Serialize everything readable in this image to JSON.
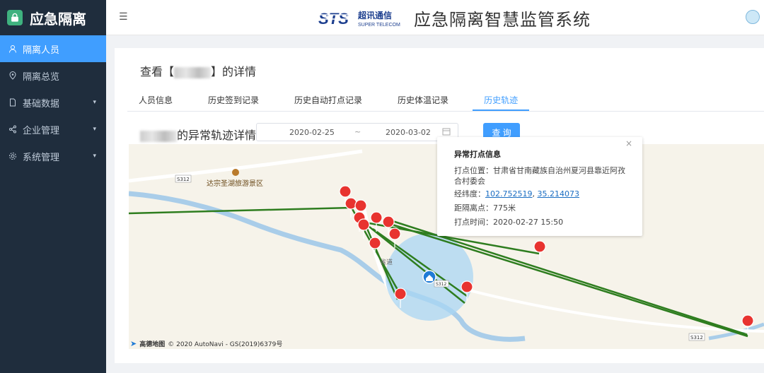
{
  "sidebar": {
    "brand": "应急隔离",
    "items": [
      {
        "label": "隔离人员",
        "icon": "user-icon",
        "active": true,
        "expandable": false
      },
      {
        "label": "隔离总览",
        "icon": "location-icon",
        "active": false,
        "expandable": false
      },
      {
        "label": "基础数据",
        "icon": "document-icon",
        "active": false,
        "expandable": true
      },
      {
        "label": "企业管理",
        "icon": "share-icon",
        "active": false,
        "expandable": true
      },
      {
        "label": "系统管理",
        "icon": "gear-icon",
        "active": false,
        "expandable": true
      }
    ]
  },
  "header": {
    "logo_cn": "超讯通信",
    "logo_en": "SUPER TELECOM",
    "system_title": "应急隔离智慧监管系统"
  },
  "detail": {
    "title_prefix": "查看【",
    "title_suffix": "】的详情",
    "tabs": [
      {
        "label": "人员信息",
        "active": false
      },
      {
        "label": "历史签到记录",
        "active": false
      },
      {
        "label": "历史自动打点记录",
        "active": false
      },
      {
        "label": "历史体温记录",
        "active": false
      },
      {
        "label": "历史轨迹",
        "active": true
      }
    ],
    "sub_title_suffix": "的异常轨迹详情",
    "date_start": "2020-02-25",
    "date_sep": "~",
    "date_end": "2020-03-02",
    "query_label": "查 询"
  },
  "map": {
    "labels": {
      "scenic": "达宗圣湖旅游景区",
      "road1": "S312",
      "road2": "S312",
      "road3": "省道",
      "road4": "S312"
    },
    "attribution_brand": "高德地图",
    "attribution": "© 2020 AutoNavi - GS(2019)6379号"
  },
  "popup": {
    "title": "异常打点信息",
    "location_label": "打点位置：",
    "location_value": "甘肃省甘南藏族自治州夏河县靠近阿孜合村委会",
    "coord_label": "经纬度：",
    "lng": "102.752519",
    "lat": "35.214073",
    "coord_sep": ", ",
    "distance_label": "距隔离点：",
    "distance_value": "775米",
    "time_label": "打点时间：",
    "time_value": "2020-02-27 15:50",
    "close": "×"
  },
  "colors": {
    "active": "#409eff",
    "sidebar": "#1f2d3d",
    "track": "#2e7d1f",
    "marker": "#e8332f"
  }
}
